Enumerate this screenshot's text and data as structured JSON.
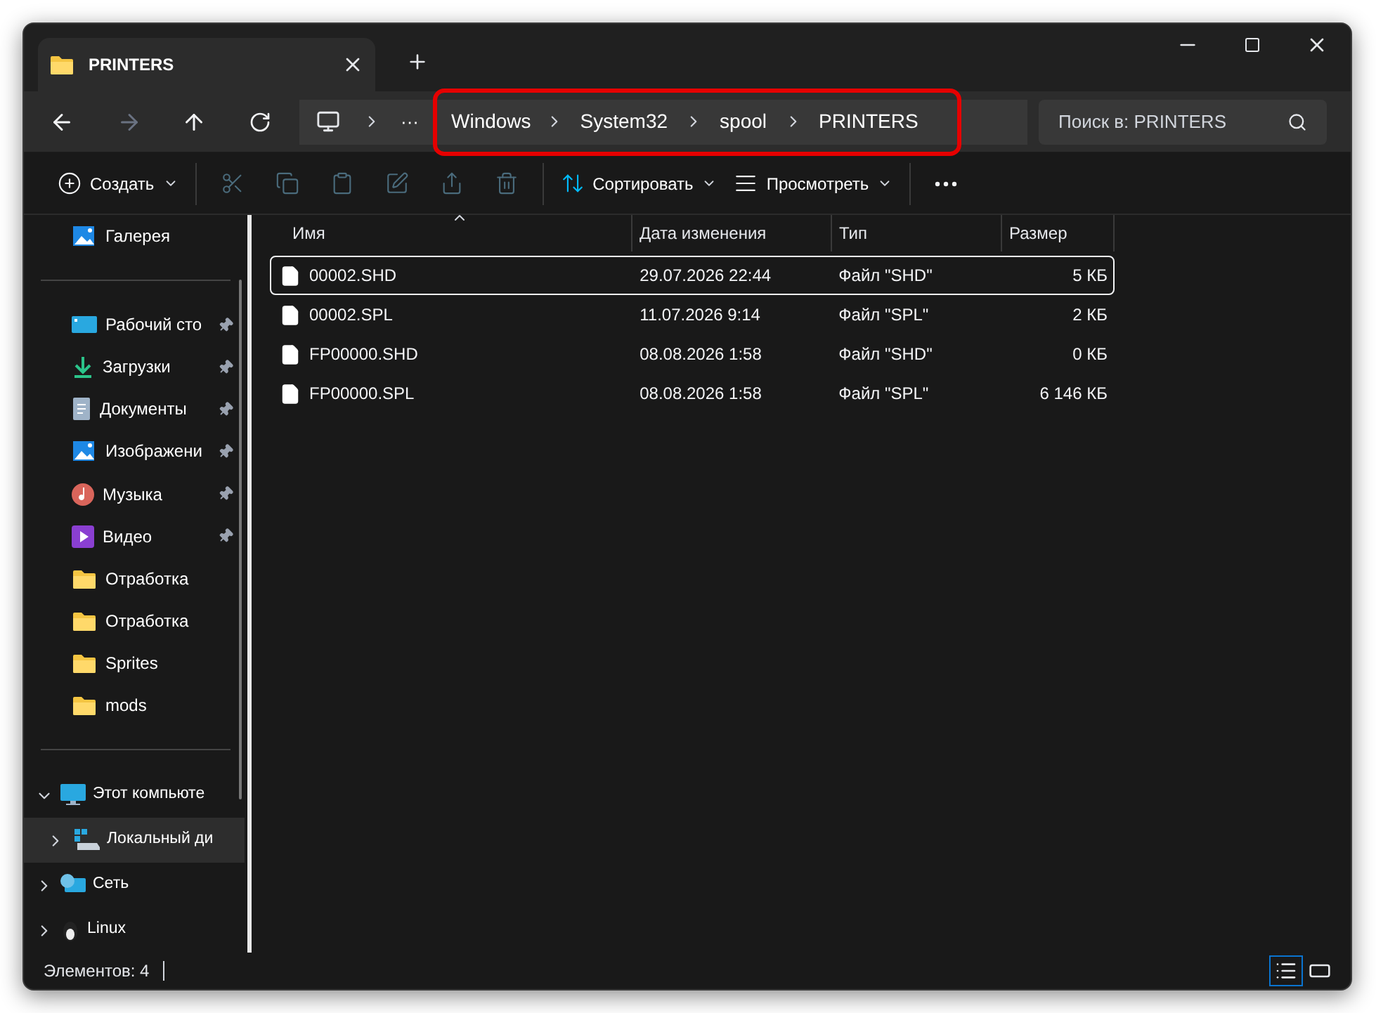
{
  "tab": {
    "title": "PRINTERS"
  },
  "address": {
    "crumbs": [
      {
        "label": "···",
        "highlighted": false
      },
      {
        "label": "Windows",
        "highlighted": true
      },
      {
        "label": "System32",
        "highlighted": true
      },
      {
        "label": "spool",
        "highlighted": true
      },
      {
        "label": "PRINTERS",
        "highlighted": true
      }
    ]
  },
  "search": {
    "placeholder": "Поиск в: PRINTERS"
  },
  "toolbar": [
    {
      "kind": "create",
      "label": "Создать",
      "disabled": false
    },
    {
      "kind": "cut",
      "disabled": true
    },
    {
      "kind": "copy",
      "disabled": true
    },
    {
      "kind": "paste",
      "disabled": true
    },
    {
      "kind": "rename",
      "disabled": true
    },
    {
      "kind": "share",
      "disabled": true
    },
    {
      "kind": "delete",
      "disabled": true
    },
    {
      "kind": "sort",
      "label": "Сортировать",
      "disabled": false
    },
    {
      "kind": "view",
      "label": "Просмотреть",
      "disabled": false
    },
    {
      "kind": "more",
      "disabled": false
    }
  ],
  "sidebar": {
    "quick": [
      {
        "label": "Галерея",
        "kind": "gallery",
        "pinned": false
      }
    ],
    "pinned": [
      {
        "label": "Рабочий сто",
        "kind": "desktop",
        "pinned": true
      },
      {
        "label": "Загрузки",
        "kind": "download",
        "pinned": true
      },
      {
        "label": "Документы",
        "kind": "document",
        "pinned": true
      },
      {
        "label": "Изображени",
        "kind": "picture",
        "pinned": true
      },
      {
        "label": "Музыка",
        "kind": "music",
        "pinned": true
      },
      {
        "label": "Видео",
        "kind": "video",
        "pinned": true
      },
      {
        "label": "Отработка",
        "kind": "folder",
        "pinned": false
      },
      {
        "label": "Отработка",
        "kind": "folder",
        "pinned": false
      },
      {
        "label": "Sprites",
        "kind": "folder",
        "pinned": false
      },
      {
        "label": "mods",
        "kind": "folder",
        "pinned": false
      }
    ],
    "tree": [
      {
        "label": "Этот компьюте",
        "kind": "computer",
        "expanded": true,
        "selected": false,
        "children": [
          {
            "label": "Локальный ди",
            "kind": "drive",
            "expanded": false,
            "selected": true
          }
        ]
      },
      {
        "label": "Сеть",
        "kind": "network",
        "expanded": false,
        "selected": false
      },
      {
        "label": "Linux",
        "kind": "linux",
        "expanded": false,
        "selected": false
      }
    ]
  },
  "table": {
    "columns": [
      {
        "label": "Имя",
        "sorted": true
      },
      {
        "label": "Дата изменения",
        "sorted": false
      },
      {
        "label": "Тип",
        "sorted": false
      },
      {
        "label": "Размер",
        "sorted": false
      }
    ],
    "rows": [
      {
        "name": "00002.SHD",
        "date": "29.07.2026 22:44",
        "type": "Файл \"SHD\"",
        "size": "5 КБ",
        "selected": true
      },
      {
        "name": "00002.SPL",
        "date": "11.07.2026 9:14",
        "type": "Файл \"SPL\"",
        "size": "2 КБ",
        "selected": false
      },
      {
        "name": "FP00000.SHD",
        "date": "08.08.2026 1:58",
        "type": "Файл \"SHD\"",
        "size": "0 КБ",
        "selected": false
      },
      {
        "name": "FP00000.SPL",
        "date": "08.08.2026 1:58",
        "type": "Файл \"SPL\"",
        "size": "6 146 КБ",
        "selected": false
      }
    ]
  },
  "status_bar": {
    "count": "Элементов: 4",
    "views": [
      {
        "kind": "details",
        "selected": true
      },
      {
        "kind": "tiles",
        "selected": false
      }
    ]
  }
}
